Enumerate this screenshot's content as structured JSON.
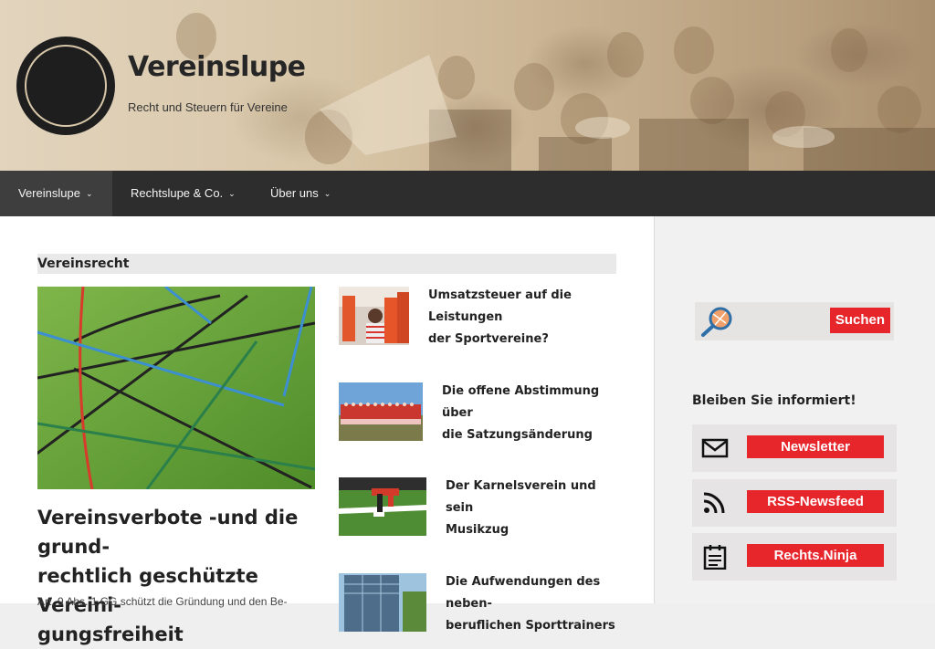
{
  "site": {
    "title": "Vereinslupe",
    "tagline": "Recht und Steuern für Vereine"
  },
  "nav": {
    "items": [
      {
        "label": "Vereinslupe",
        "active": true
      },
      {
        "label": "Rechtslupe & Co.",
        "active": false
      },
      {
        "label": "Über uns",
        "active": false
      }
    ]
  },
  "main": {
    "section_title": "Vereinsrecht",
    "feature": {
      "title": "Vereinsverbote -und die grund-rechtlich geschützte Vereini-gungsfreiheit",
      "title_lines": [
        "Vereinsverbote -und die grund-",
        "rechtlich geschützte Vereini-",
        "gungsfreiheit"
      ],
      "excerpt": "Art. 9 Abs. 1 GG schützt die Gründung und den Be-"
    },
    "posts": [
      {
        "title_lines": [
          "Umsatzsteuer auf die Leistungen",
          "der Sportvereine?"
        ]
      },
      {
        "title_lines": [
          "Die offene Abstimmung über",
          "die Satzungsänderung"
        ]
      },
      {
        "title_lines": [
          "Der Karnelsverein und sein",
          "Musikzug"
        ]
      },
      {
        "title_lines": [
          "Die Aufwendungen des neben-",
          "beruflichen Sporttrainers"
        ]
      }
    ]
  },
  "sidebar": {
    "search": {
      "button_label": "Suchen"
    },
    "widget_title": "Bleiben Sie informiert!",
    "links": [
      {
        "label": "Newsletter",
        "icon": "mail-icon"
      },
      {
        "label": "RSS-Newsfeed",
        "icon": "rss-icon"
      },
      {
        "label": "Rechts.Ninja",
        "icon": "calendar-icon"
      }
    ]
  },
  "colors": {
    "nav_bg": "#2d2d2d",
    "accent_red": "#e7262c",
    "header_sepia": "#d8c6a8"
  }
}
